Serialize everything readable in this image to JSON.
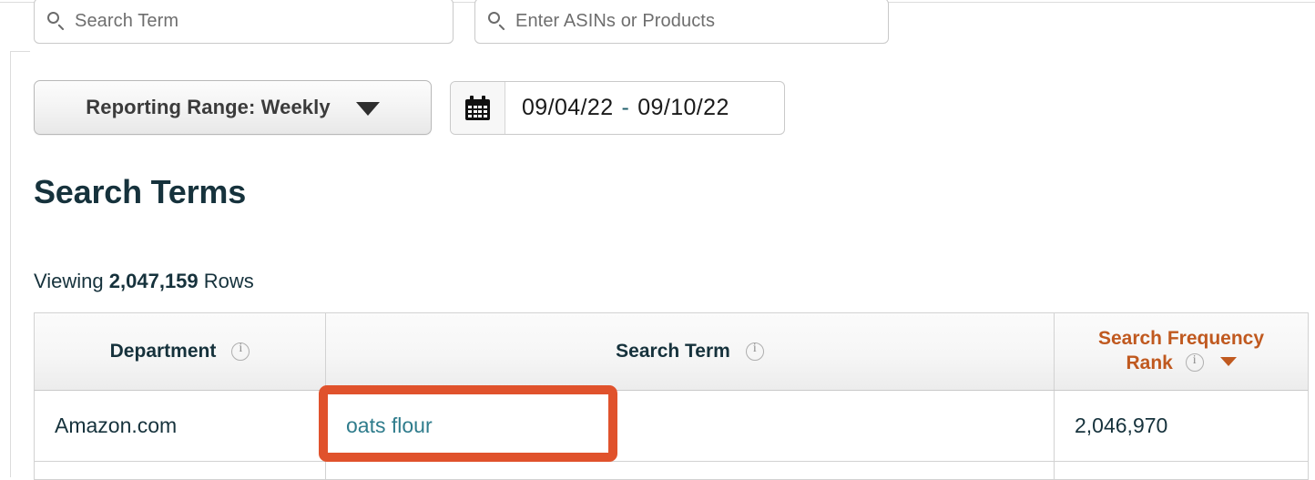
{
  "filters": {
    "search_term_input": {
      "icon": "search-icon",
      "placeholder": "Search Term",
      "value": ""
    },
    "asin_input": {
      "icon": "search-icon",
      "placeholder": "Enter ASINs or Products",
      "value": ""
    },
    "reporting_range": {
      "label": "Reporting Range: Weekly",
      "caret_icon": "chevron-down-icon"
    },
    "date_range": {
      "icon": "calendar-icon",
      "start": "09/04/22",
      "separator": "-",
      "end": "09/10/22"
    }
  },
  "page": {
    "title": "Search Terms",
    "viewing_prefix": "Viewing",
    "viewing_count": "2,047,159",
    "viewing_suffix": "Rows"
  },
  "table": {
    "columns": [
      {
        "label": "Department",
        "info_icon": "info-icon"
      },
      {
        "label": "Search Term",
        "info_icon": "info-icon"
      },
      {
        "label_line1": "Search Frequency",
        "label_line2": "Rank",
        "info_icon": "info-icon",
        "sort_icon": "sort-descending-caret-icon"
      }
    ],
    "rows": [
      {
        "department": "Amazon.com",
        "search_term": "oats flour",
        "search_frequency_rank": "2,046,970"
      }
    ]
  },
  "annotation": {
    "type": "highlight-rectangle",
    "color": "#e0522c",
    "targets": "search-term-link"
  },
  "colors": {
    "heading": "#16323c",
    "link": "#2f7c8c",
    "accent_orange": "#c0591f",
    "annotation": "#e0522c",
    "placeholder": "#6e6e6e"
  }
}
